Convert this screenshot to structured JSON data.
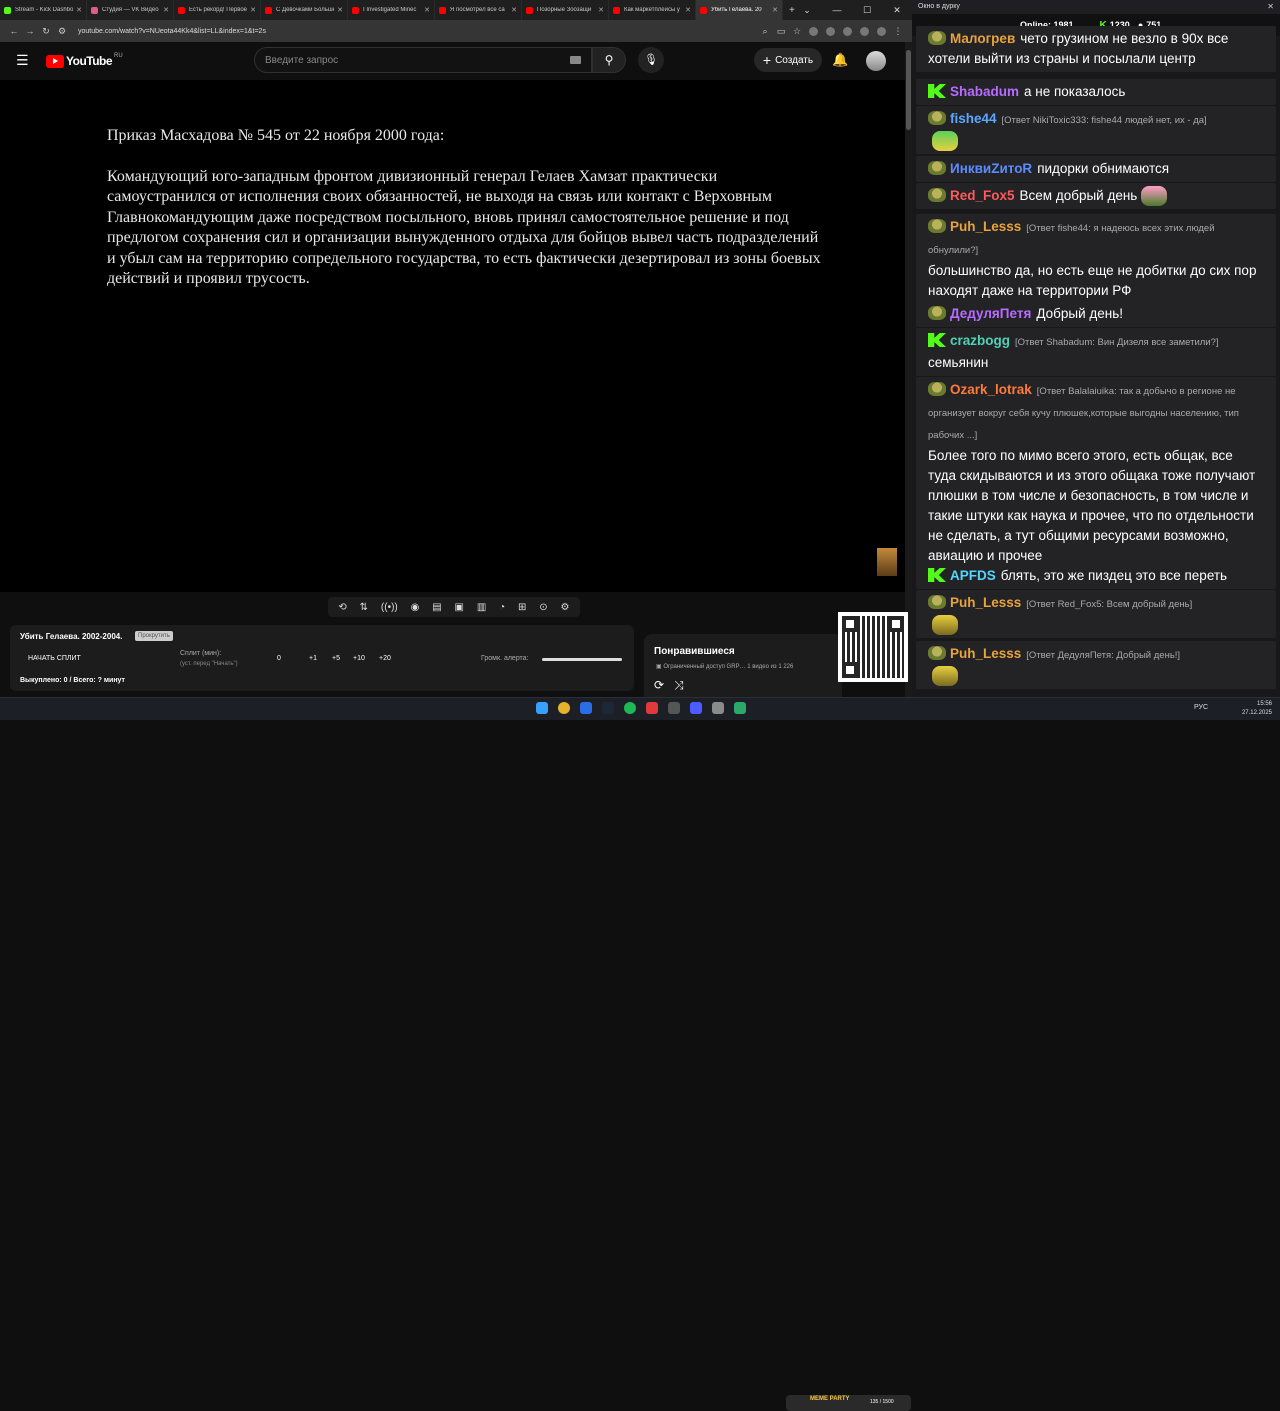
{
  "browser": {
    "tabs": [
      {
        "title": "Stream - Kick Dashbo",
        "color": "#53fc18"
      },
      {
        "title": "Студия — VK Видео",
        "color": "#e05a8a"
      },
      {
        "title": "Есть рекорд! Первое",
        "color": "#ff0000"
      },
      {
        "title": "С Девочками Больше",
        "color": "#ff0000"
      },
      {
        "title": "I Investigated Minec",
        "color": "#ff0000"
      },
      {
        "title": "Я посмотрел все са",
        "color": "#ff0000"
      },
      {
        "title": "Позорные Зоозащи",
        "color": "#ff0000"
      },
      {
        "title": "Как маркетплейсы у",
        "color": "#ff0000"
      },
      {
        "title": "Убить Гелаева. 20",
        "color": "#ff0000",
        "active": true
      }
    ],
    "url": "youtube.com/watch?v=NUeota44Kk4&list=LL&index=1&t=2s"
  },
  "youtube": {
    "logo_text": "YouTube",
    "region": "RU",
    "search_placeholder": "Введите запрос",
    "create_label": "Создать"
  },
  "video": {
    "heading": "Приказ Масхадова № 545 от 22 ноября 2000 года:",
    "body": "Командующий юго-западным фронтом дивизионный генерал Гелаев Хамзат практически самоустранился от исполнения своих обязанностей, не выходя на связь или контакт с Верховным Главнокомандующим даже посредством посыльного, вновь принял самостоятельное решение и под предлогом сохранения сил и организации вынужденного отдыха для бойцов вывел часть подразделений и убыл сам на территорию сопредельного государства, то есть фактически дезертировал из зоны боевых действий и проявил трусость."
  },
  "overlay": {
    "title": "Убить Гелаева. 2002-2004.",
    "badge": "Прокрутить",
    "start_label": "НАЧАТЬ СПЛИТ",
    "split_label": "Сплит (мин):",
    "split_hint": "(уст. перед \"Начать\")",
    "value": "0",
    "inc1": "+1",
    "inc5": "+5",
    "inc10": "+10",
    "inc20": "+20",
    "volume_label": "Громк. алерта:",
    "bought": "Выкуплено: 0 / Всего: ? минут"
  },
  "liked": {
    "title": "Понравившиеся",
    "subtitle": "▣ Ограниченный доступ  GRP…   1 видео из 1 226"
  },
  "chat": {
    "window_title": "Окно в дурку",
    "online_label": "Online:",
    "online_count": "1981",
    "kick_points": "1230",
    "coin_points": "751",
    "messages": [
      {
        "nick": "Малогрев",
        "color": "#e8a33a",
        "badge": "frog",
        "reply": "",
        "text": "чето грузином не везло в 90х все хотели выйти из страны и посылали центр"
      },
      {
        "nick": "Shabadum",
        "color": "#b86bff",
        "badge": "kick",
        "reply": "",
        "text": "а не показалось"
      },
      {
        "nick": "fishe44",
        "color": "#5ba7ff",
        "badge": "frog",
        "reply": "[Ответ NikiToxic333: fishe44 людей нет, их - да]",
        "text": ""
      },
      {
        "nick": "ИнквиZитоR",
        "color": "#5b8cff",
        "badge": "frog",
        "reply": "",
        "text": "пидорки обнимаются"
      },
      {
        "nick": "Red_Fox5",
        "color": "#ff5a5a",
        "badge": "frog",
        "reply": "",
        "text": "Всем добрый день"
      },
      {
        "nick": "Puh_Lesss",
        "color": "#e8a33a",
        "badge": "frog",
        "reply": "[Ответ fishe44: я надеюсь всех этих людей обнулили?]",
        "text": "большинство да, но есть еще не добитки до сих пор находят даже на территории РФ"
      },
      {
        "nick": "ДедуляПетя",
        "color": "#b86bff",
        "badge": "frog",
        "reply": "",
        "text": "Добрый день!"
      },
      {
        "nick": "crazbogg",
        "color": "#4fd1b5",
        "badge": "kick",
        "reply": "[Ответ Shabadum: Вин Дизеля все заметили?]",
        "text": "семьянин"
      },
      {
        "nick": "Ozark_lotrak",
        "color": "#ff7a3a",
        "badge": "frog",
        "reply": "[Ответ Balalaiuika: так а добычо в регионе не организует вокруг себя кучу плюшек,которые выгодны населению, тип рабочих ...]",
        "text": "Более того по мимо всего этого, есть общак, все туда скидываются и из этого общака тоже получают плюшки в том числе и безопасность, в том числе и такие штуки как наука и прочее, что по отдельности не сделать, а тут общими ресурсами возможно, авиацию и прочее"
      },
      {
        "nick": "APFDS",
        "color": "#53d6ff",
        "badge": "kick",
        "reply": "",
        "text": "блять, это же пиздец это все переть"
      },
      {
        "nick": "Puh_Lesss",
        "color": "#e8a33a",
        "badge": "frog",
        "reply": "[Ответ Red_Fox5: Всем добрый день]",
        "text": ""
      },
      {
        "nick": "Puh_Lesss",
        "color": "#e8a33a",
        "badge": "frog",
        "reply": "[Ответ ДедуляПетя: Добрый день!]",
        "text": ""
      }
    ]
  },
  "taskbar": {
    "lang": "РУС",
    "time": "15:56",
    "date": "27.12.2025"
  },
  "meme": {
    "label": "MEME PARTY",
    "value": "135 / 1500"
  }
}
